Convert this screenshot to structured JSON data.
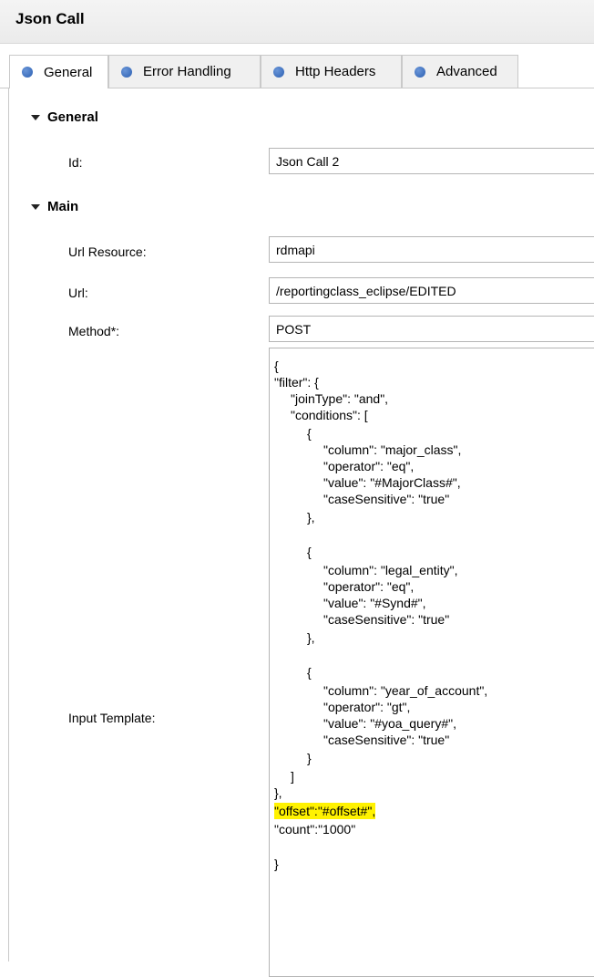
{
  "window": {
    "title": "Json Call"
  },
  "tabs": [
    {
      "label": "General"
    },
    {
      "label": "Error Handling"
    },
    {
      "label": "Http Headers"
    },
    {
      "label": "Advanced"
    }
  ],
  "sections": {
    "general": {
      "title": "General",
      "id_label": "Id:",
      "id_value": "Json Call 2"
    },
    "main": {
      "title": "Main",
      "url_resource_label": "Url Resource:",
      "url_resource_value": "rdmapi",
      "url_label": "Url:",
      "url_value": "/reportingclass_eclipse/EDITED",
      "method_label": "Method*:",
      "method_value": "POST",
      "input_template_label": "Input Template:"
    }
  },
  "input_template": {
    "lines": [
      "{",
      "\"filter\": {",
      "\"joinType\": \"and\",",
      "\"conditions\": [",
      "{",
      "\"column\": \"major_class\",",
      "\"operator\": \"eq\",",
      "\"value\": \"#MajorClass#\",",
      "\"caseSensitive\": \"true\"",
      "},",
      "{",
      "\"column\": \"legal_entity\",",
      "\"operator\": \"eq\",",
      "\"value\": \"#Synd#\",",
      "\"caseSensitive\": \"true\"",
      "},",
      "{",
      "\"column\": \"year_of_account\",",
      "\"operator\": \"gt\",",
      "\"value\": \"#yoa_query#\",",
      "\"caseSensitive\": \"true\"",
      "}",
      "]",
      "},",
      "\"offset\":\"#offset#\",",
      "\"count\":\"1000\"",
      "",
      "}"
    ],
    "highlighted_line": "\"offset\":\"#offset#\",",
    "highlight_color": "#fff200"
  },
  "colors": {
    "tab_dot": "#2b5fb2",
    "title_bg": "#ebebeb"
  }
}
